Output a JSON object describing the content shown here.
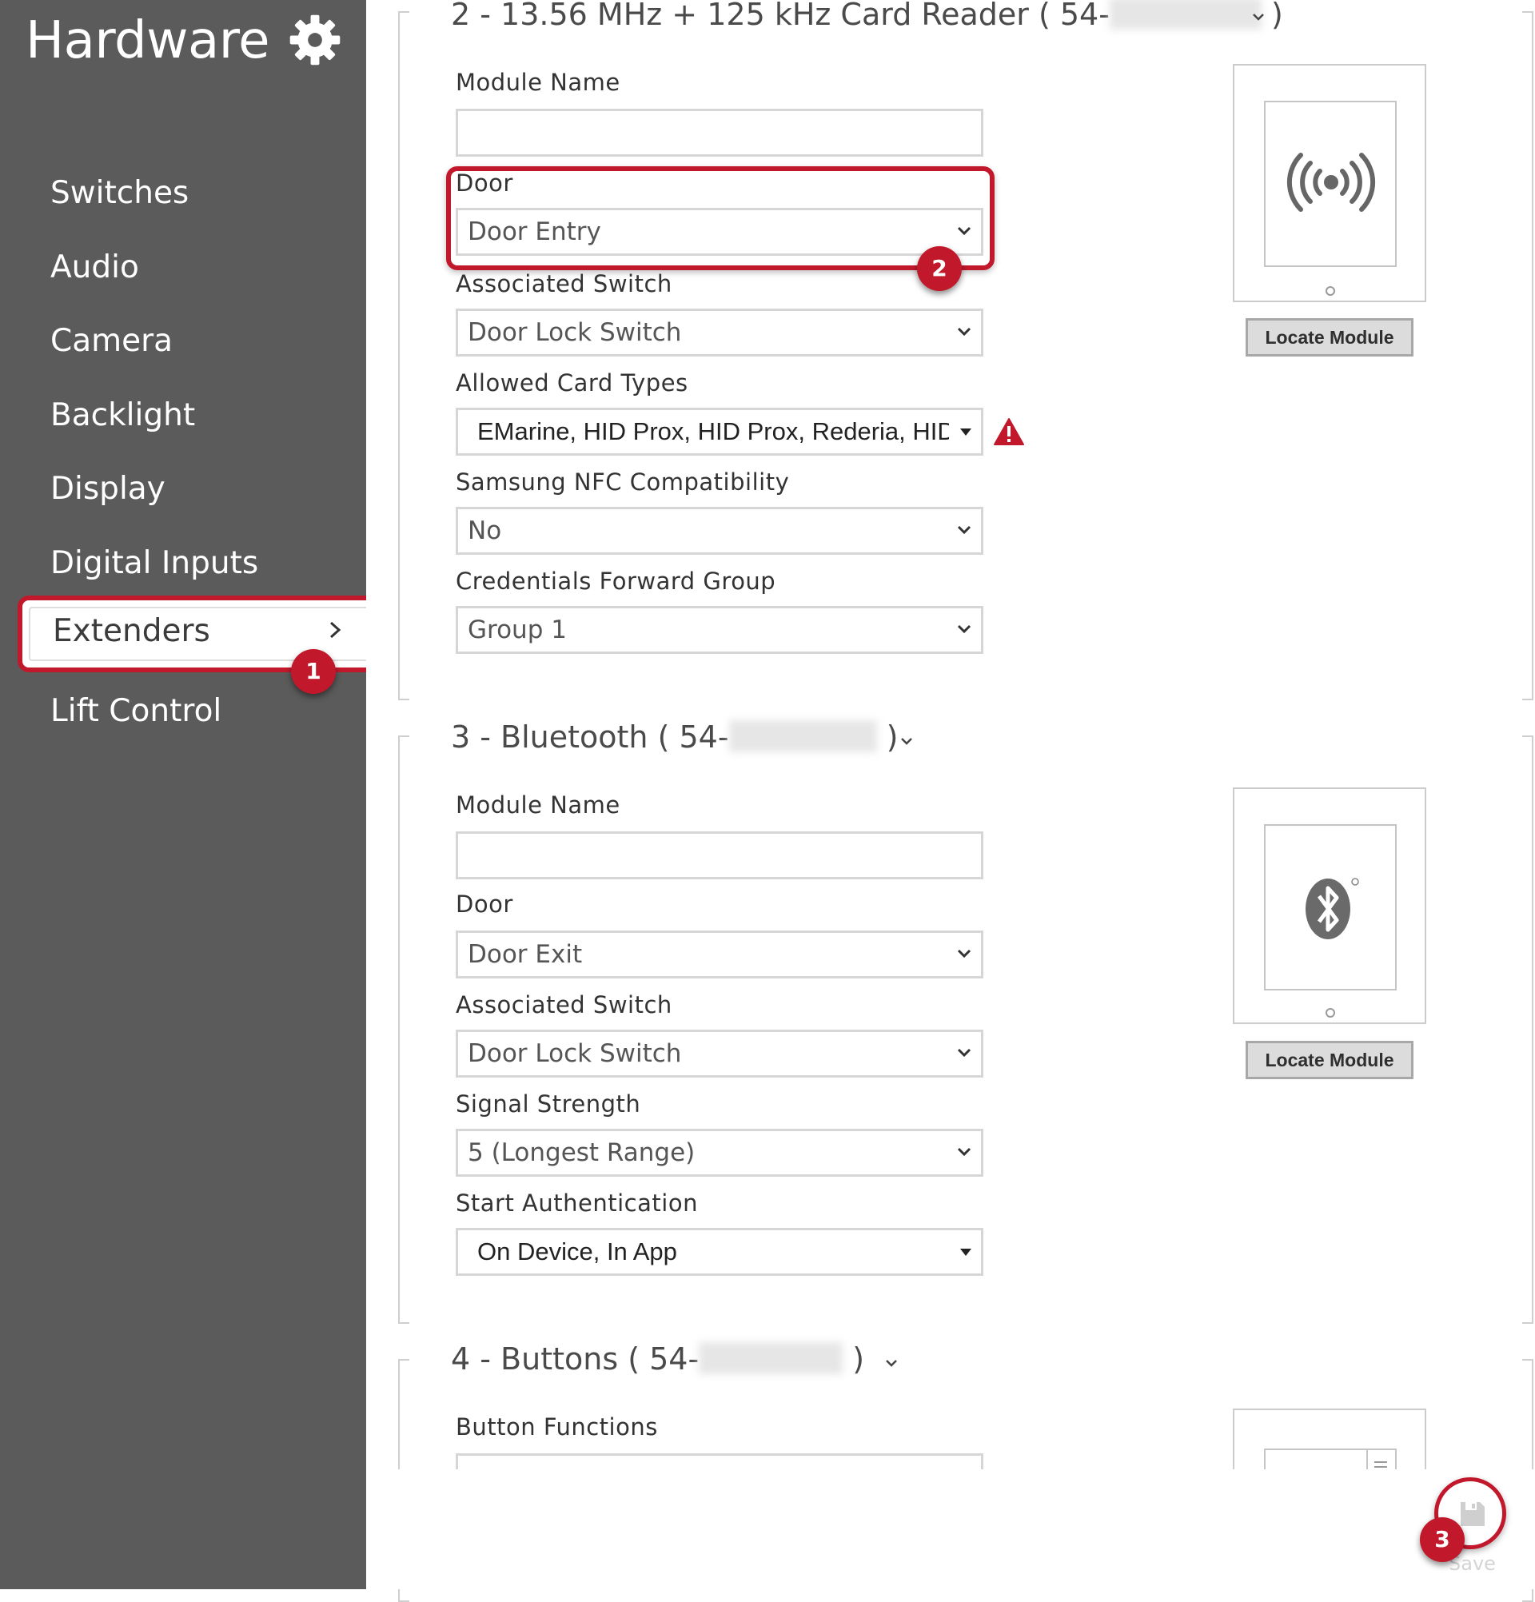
{
  "sidebar": {
    "title": "Hardware",
    "items": [
      {
        "label": "Switches"
      },
      {
        "label": "Audio"
      },
      {
        "label": "Camera"
      },
      {
        "label": "Backlight"
      },
      {
        "label": "Display"
      },
      {
        "label": "Digital Inputs"
      },
      {
        "label": "Extenders"
      },
      {
        "label": "Lift Control"
      }
    ],
    "active_item": "Extenders"
  },
  "callouts": [
    "1",
    "2",
    "3"
  ],
  "modules": [
    {
      "title": "2 - 13.56 MHz + 125 kHz Card Reader ( 54-",
      "title_suffix": ")",
      "fields": {
        "module_name": {
          "label": "Module Name",
          "value": ""
        },
        "door": {
          "label": "Door",
          "value": "Door Entry"
        },
        "associated_switch": {
          "label": "Associated Switch",
          "value": "Door Lock Switch"
        },
        "allowed_card_types": {
          "label": "Allowed Card Types",
          "value": "EMarine, HID Prox, HID Prox, Rederia, HID"
        },
        "samsung_nfc": {
          "label": "Samsung NFC Compatibility",
          "value": "No"
        },
        "credentials_forward_group": {
          "label": "Credentials Forward Group",
          "value": "Group 1"
        }
      },
      "locate_label": "Locate Module",
      "icon": "rfid-waves-icon"
    },
    {
      "title": "3 - Bluetooth ( 54-",
      "title_suffix": ")",
      "fields": {
        "module_name": {
          "label": "Module Name",
          "value": ""
        },
        "door": {
          "label": "Door",
          "value": "Door Exit"
        },
        "associated_switch": {
          "label": "Associated Switch",
          "value": "Door Lock Switch"
        },
        "signal_strength": {
          "label": "Signal Strength",
          "value": "5 (Longest Range)"
        },
        "start_authentication": {
          "label": "Start Authentication",
          "value": "On Device, In App"
        }
      },
      "locate_label": "Locate Module",
      "icon": "bluetooth-icon"
    },
    {
      "title": "4 - Buttons ( 54-",
      "title_suffix": ")",
      "fields": {
        "button_functions": {
          "label": "Button Functions"
        }
      }
    }
  ],
  "save": {
    "label": "Save"
  },
  "colors": {
    "sidebar_bg": "#5b5b5b",
    "accent": "#c1182b",
    "warning": "#c1182b"
  }
}
